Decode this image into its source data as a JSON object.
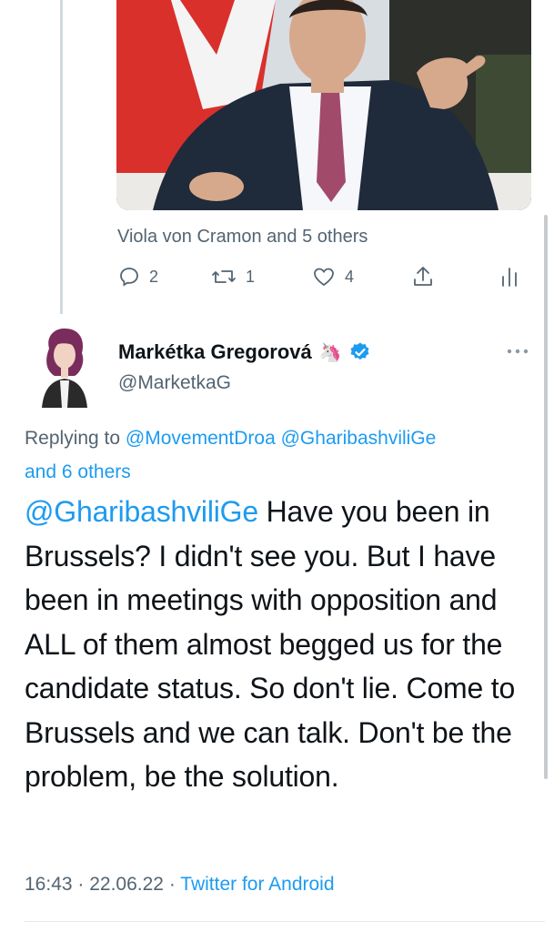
{
  "quoted_tweet": {
    "liked_by": "Viola von Cramon and 5 others",
    "replies": "2",
    "retweets": "1",
    "likes": "4",
    "icons": [
      "reply-icon",
      "retweet-icon",
      "like-icon",
      "share-icon",
      "analytics-icon"
    ]
  },
  "tweet": {
    "author_name": "Markétka Gregorová",
    "name_emoji": "🦄",
    "verified": true,
    "handle": "@MarketkaG",
    "replying_label": "Replying to",
    "replying_mentions": "@MovementDroa @GharibashviliGe",
    "replying_others": "and 6 others",
    "mention": "@GharibashviliGe",
    "text": " Have you been in Brussels? I didn't see you. But I have been in meetings with opposition and ALL of them almost begged us for the candidate status. So don't lie. Come to Brussels and we can talk. Don't be the problem, be the solution.",
    "time": "16:43",
    "sep1": " · ",
    "date": "22.06.22",
    "sep2": " · ",
    "source": "Twitter for Android"
  },
  "colors": {
    "accent": "#1d9bf0",
    "secondary_text": "#536471",
    "primary_text": "#0f1419"
  }
}
